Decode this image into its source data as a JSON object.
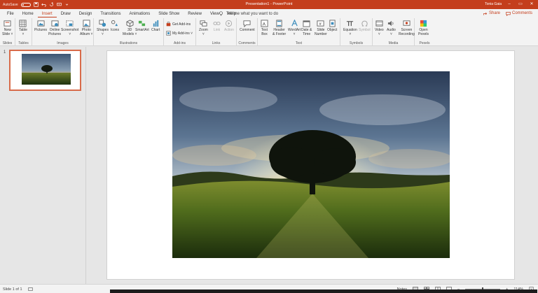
{
  "titlebar": {
    "autosave_label": "AutoSave",
    "autosave_state": "Off",
    "title": "Presentation1 - PowerPoint",
    "user": "Tonia Gaia",
    "minimize": "–",
    "restore": "▭",
    "close": "✕"
  },
  "tabs": [
    "File",
    "Home",
    "Insert",
    "Draw",
    "Design",
    "Transitions",
    "Animations",
    "Slide Show",
    "Review",
    "View",
    "Help"
  ],
  "active_tab": "Insert",
  "tell_me": "Tell me what you want to do",
  "share": "Share",
  "comments": "Comments",
  "ribbon": {
    "slides": {
      "label": "Slides",
      "new_slide": "New",
      "new_slide2": "Slide ˅"
    },
    "tables": {
      "label": "Tables",
      "table": "Table",
      "table2": "˅"
    },
    "images": {
      "label": "Images",
      "pictures": "Pictures",
      "online": "Online",
      "online2": "Pictures",
      "screenshot": "Screenshot",
      "screenshot2": "˅",
      "album": "Photo",
      "album2": "Album ˅"
    },
    "illustrations": {
      "label": "Illustrations",
      "shapes": "Shapes",
      "shapes2": "˅",
      "icons": "Icons",
      "models": "3D",
      "models2": "Models ˅",
      "smartart": "SmartArt",
      "chart": "Chart"
    },
    "addins": {
      "label": "Add-ins",
      "get": "Get Add-ins",
      "my": "My Add-ins ˅"
    },
    "links": {
      "label": "Links",
      "zoom": "Zoom",
      "zoom2": "˅",
      "link": "Link",
      "action": "Action"
    },
    "comments": {
      "label": "Comments",
      "comment": "Comment"
    },
    "text": {
      "label": "Text",
      "textbox": "Text",
      "textbox2": "Box",
      "header": "Header",
      "header2": "& Footer",
      "wordart": "WordArt",
      "wordart2": "˅",
      "datetime": "Date &",
      "datetime2": "Time",
      "slidenum": "Slide",
      "slidenum2": "Number",
      "object": "Object"
    },
    "symbols": {
      "label": "Symbols",
      "equation": "Equation",
      "equation2": "˅",
      "symbol": "Symbol"
    },
    "media": {
      "label": "Media",
      "video": "Video",
      "video2": "˅",
      "audio": "Audio",
      "audio2": "˅",
      "screenrec": "Screen",
      "screenrec2": "Recording"
    },
    "pexels": {
      "label": "Pexels",
      "open": "Open",
      "open2": "Pexels"
    }
  },
  "slide_pane": {
    "number": "1"
  },
  "status": {
    "slide_of": "Slide 1 of 1",
    "notes": "Notes",
    "zoom": "114%"
  }
}
